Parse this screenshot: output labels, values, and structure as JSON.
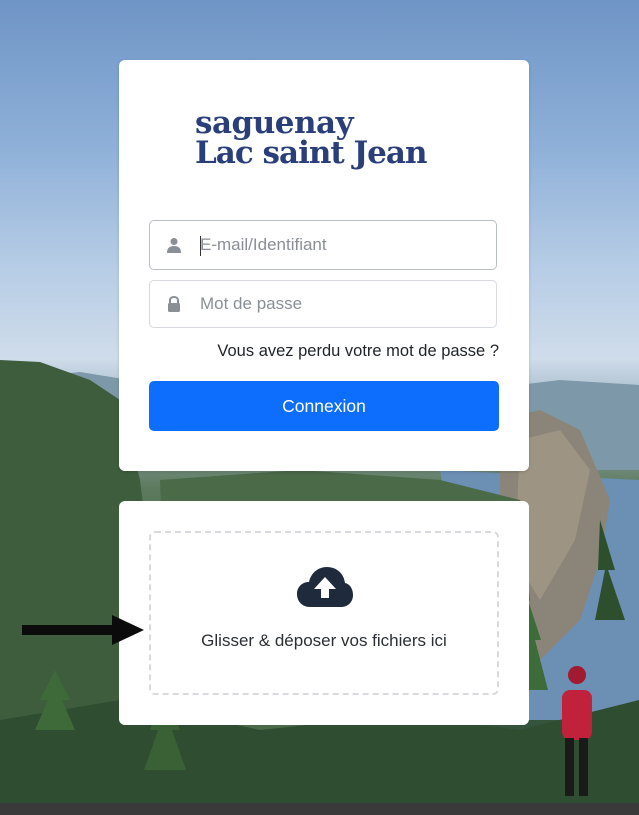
{
  "logo": {
    "line1": "saguenay",
    "line2": "Lac saint Jean"
  },
  "login": {
    "email_placeholder": "E-mail/Identifiant",
    "password_placeholder": "Mot de passe",
    "forgot_label": "Vous avez perdu votre mot de passe ?",
    "connect_label": "Connexion"
  },
  "upload": {
    "drop_label": "Glisser & déposer vos fichiers ici"
  },
  "icons": {
    "email": "user-icon",
    "password": "lock-icon",
    "upload": "cloud-upload-icon",
    "pointer": "arrow-right-icon"
  },
  "colors": {
    "primary": "#0d6efd",
    "logo": "#2a3f7a",
    "icon": "#1f2b3d"
  }
}
